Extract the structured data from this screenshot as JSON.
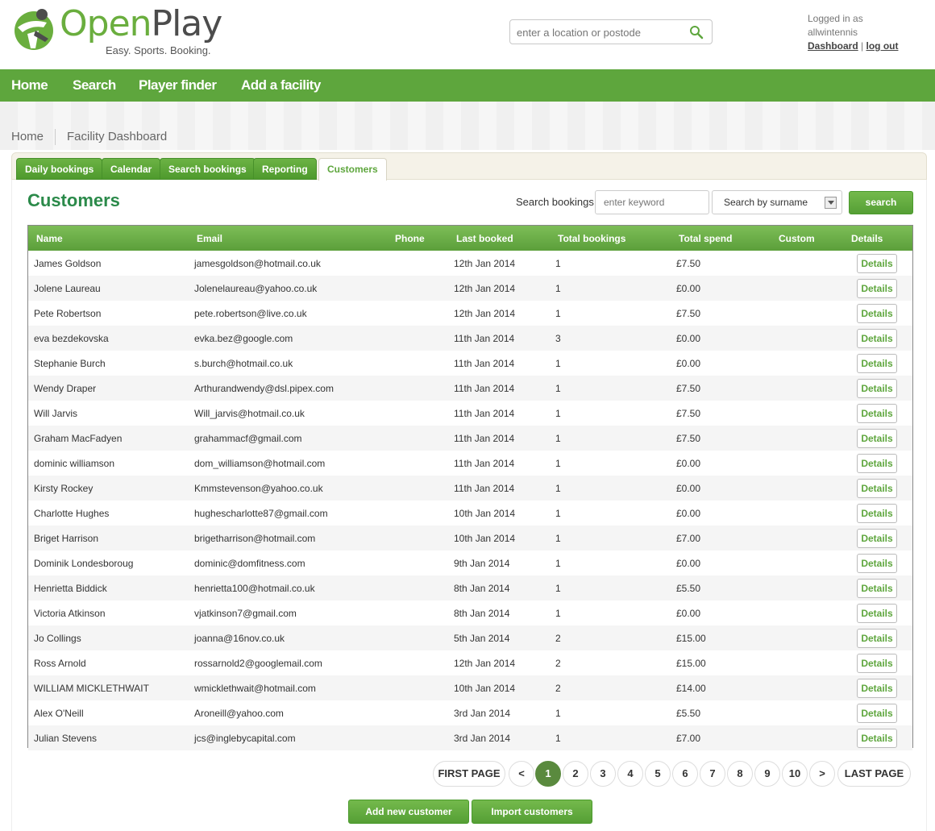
{
  "header": {
    "logo_open": "Open",
    "logo_play": "Play",
    "tagline": "Easy. Sports. Booking.",
    "location_placeholder": "enter a location or postode",
    "logged_in_line1": "Logged in as",
    "username": "allwintennis",
    "dashboard_link": "Dashboard",
    "separator": "|",
    "logout_link": "log out"
  },
  "nav": [
    "Home",
    "Search",
    "Player finder",
    "Add a facility"
  ],
  "breadcrumb": [
    "Home",
    "Facility Dashboard"
  ],
  "tabs": [
    {
      "label": "Daily bookings",
      "active": false
    },
    {
      "label": "Calendar",
      "active": false
    },
    {
      "label": "Search bookings",
      "active": false
    },
    {
      "label": "Reporting",
      "active": false
    },
    {
      "label": "Customers",
      "active": true
    }
  ],
  "page_title": "Customers",
  "search": {
    "label": "Search bookings",
    "keyword_placeholder": "enter keyword",
    "select_value": "Search by surname",
    "button_label": "search"
  },
  "table": {
    "headers": [
      "Name",
      "Email",
      "Phone",
      "Last booked",
      "Total bookings",
      "Total spend",
      "Custom",
      "Details"
    ],
    "rows": [
      {
        "name": "James Goldson",
        "email": "jamesgoldson@hotmail.co.uk",
        "phone": "",
        "last_booked": "12th Jan 2014",
        "total_bookings": "1",
        "total_spend": "£7.50",
        "custom": "",
        "details": "Details"
      },
      {
        "name": "Jolene Laureau",
        "email": "Jolenelaureau@yahoo.co.uk",
        "phone": "",
        "last_booked": "12th Jan 2014",
        "total_bookings": "1",
        "total_spend": "£0.00",
        "custom": "",
        "details": "Details"
      },
      {
        "name": "Pete Robertson",
        "email": "pete.robertson@live.co.uk",
        "phone": "",
        "last_booked": "12th Jan 2014",
        "total_bookings": "1",
        "total_spend": "£7.50",
        "custom": "",
        "details": "Details"
      },
      {
        "name": "eva bezdekovska",
        "email": "evka.bez@google.com",
        "phone": "",
        "last_booked": "11th Jan 2014",
        "total_bookings": "3",
        "total_spend": "£0.00",
        "custom": "",
        "details": "Details"
      },
      {
        "name": "Stephanie Burch",
        "email": "s.burch@hotmail.co.uk",
        "phone": "",
        "last_booked": "11th Jan 2014",
        "total_bookings": "1",
        "total_spend": "£0.00",
        "custom": "",
        "details": "Details"
      },
      {
        "name": "Wendy Draper",
        "email": "Arthurandwendy@dsl.pipex.com",
        "phone": "",
        "last_booked": "11th Jan 2014",
        "total_bookings": "1",
        "total_spend": "£7.50",
        "custom": "",
        "details": "Details"
      },
      {
        "name": "Will Jarvis",
        "email": "Will_jarvis@hotmail.co.uk",
        "phone": "",
        "last_booked": "11th Jan 2014",
        "total_bookings": "1",
        "total_spend": "£7.50",
        "custom": "",
        "details": "Details"
      },
      {
        "name": "Graham MacFadyen",
        "email": "grahammacf@gmail.com",
        "phone": "",
        "last_booked": "11th Jan 2014",
        "total_bookings": "1",
        "total_spend": "£7.50",
        "custom": "",
        "details": "Details"
      },
      {
        "name": "dominic williamson",
        "email": "dom_williamson@hotmail.com",
        "phone": "",
        "last_booked": "11th Jan 2014",
        "total_bookings": "1",
        "total_spend": "£0.00",
        "custom": "",
        "details": "Details"
      },
      {
        "name": "Kirsty Rockey",
        "email": "Kmmstevenson@yahoo.co.uk",
        "phone": "",
        "last_booked": "11th Jan 2014",
        "total_bookings": "1",
        "total_spend": "£0.00",
        "custom": "",
        "details": "Details"
      },
      {
        "name": "Charlotte Hughes",
        "email": "hughescharlotte87@gmail.com",
        "phone": "",
        "last_booked": "10th Jan 2014",
        "total_bookings": "1",
        "total_spend": "£0.00",
        "custom": "",
        "details": "Details"
      },
      {
        "name": "Briget Harrison",
        "email": "brigetharrison@hotmail.com",
        "phone": "",
        "last_booked": "10th Jan 2014",
        "total_bookings": "1",
        "total_spend": "£7.00",
        "custom": "",
        "details": "Details"
      },
      {
        "name": "Dominik Londesboroug",
        "email": "dominic@domfitness.com",
        "phone": "",
        "last_booked": "9th Jan 2014",
        "total_bookings": "1",
        "total_spend": "£0.00",
        "custom": "",
        "details": "Details"
      },
      {
        "name": "Henrietta Biddick",
        "email": "henrietta100@hotmail.co.uk",
        "phone": "",
        "last_booked": "8th Jan 2014",
        "total_bookings": "1",
        "total_spend": "£5.50",
        "custom": "",
        "details": "Details"
      },
      {
        "name": "Victoria Atkinson",
        "email": "vjatkinson7@gmail.com",
        "phone": "",
        "last_booked": "8th Jan 2014",
        "total_bookings": "1",
        "total_spend": "£0.00",
        "custom": "",
        "details": "Details"
      },
      {
        "name": "Jo Collings",
        "email": "joanna@16nov.co.uk",
        "phone": "",
        "last_booked": "5th Jan 2014",
        "total_bookings": "2",
        "total_spend": "£15.00",
        "custom": "",
        "details": "Details"
      },
      {
        "name": "Ross Arnold",
        "email": "rossarnold2@googlemail.com",
        "phone": "",
        "last_booked": "12th Jan 2014",
        "total_bookings": "2",
        "total_spend": "£15.00",
        "custom": "",
        "details": "Details"
      },
      {
        "name": "WILLIAM MICKLETHWAIT",
        "email": "wmicklethwait@hotmail.com",
        "phone": "",
        "last_booked": "10th Jan 2014",
        "total_bookings": "2",
        "total_spend": "£14.00",
        "custom": "",
        "details": "Details"
      },
      {
        "name": "Alex O'Neill",
        "email": "Aroneill@yahoo.com",
        "phone": "",
        "last_booked": "3rd Jan 2014",
        "total_bookings": "1",
        "total_spend": "£5.50",
        "custom": "",
        "details": "Details"
      },
      {
        "name": "Julian Stevens",
        "email": "jcs@inglebycapital.com",
        "phone": "",
        "last_booked": "3rd Jan 2014",
        "total_bookings": "1",
        "total_spend": "£7.00",
        "custom": "",
        "details": "Details"
      }
    ]
  },
  "pagination": {
    "first": "FIRST PAGE",
    "prev": "<",
    "pages": [
      "1",
      "2",
      "3",
      "4",
      "5",
      "6",
      "7",
      "8",
      "9",
      "10"
    ],
    "current": "1",
    "next": ">",
    "last": "LAST PAGE"
  },
  "actions": {
    "add_customer": "Add new customer",
    "import_customers": "Import customers"
  },
  "colors": {
    "brand_green": "#5ea63d",
    "title_green": "#2b8a4a"
  }
}
